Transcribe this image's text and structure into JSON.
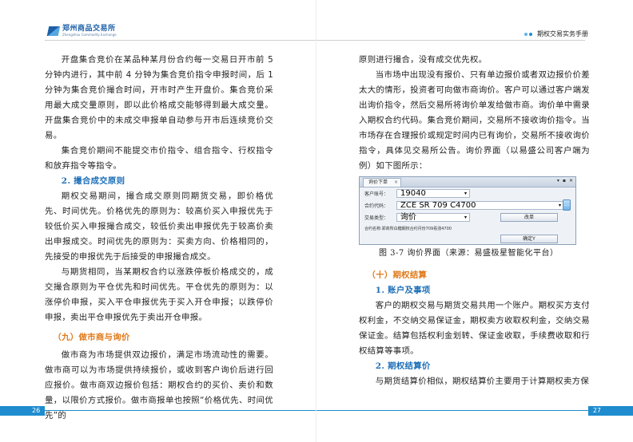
{
  "header": {
    "logo_cn": "郑州商品交易所",
    "logo_en": "Zhengzhou Commodity Exchange",
    "book_title": "期权交易实务手册",
    "dot_colors": [
      "#5fb3e8",
      "#1e8ccf"
    ]
  },
  "left_page": {
    "page_number": "26",
    "paragraphs": [
      {
        "type": "body_cont",
        "text": "开盘集合竞价在某品种某月份合约每一交易日开市前 5 分钟内进行，其中前 4 分钟为集合竞价指令申报时间，后 1 分钟为集合竞价撮合时间，开市时产生开盘价。集合竞价采用最大成交量原则，即以此价格成交能够得到最大成交量。开盘集合竞价中的未成交申报单自动参与开市后连续竞价交易。"
      },
      {
        "type": "body",
        "text": "集合竞价期间不能提交市价指令、组合指令、行权指令和放弃指令等指令。"
      },
      {
        "type": "h2",
        "text": "2. 撮合成交原则"
      },
      {
        "type": "body",
        "text": "期权交易期间，撮合成交原则同期货交易，即价格优先、时间优先。价格优先的原则为：较高价买入申报优先于较低价买入申报撮合成交，较低价卖出申报优先于较高价卖出申报成交。时间优先的原则为：买卖方向、价格相同的，先接受的申报优先于后接受的申报撮合成交。"
      },
      {
        "type": "body",
        "text": "与期货相同，当某期权合约以涨跌停板价格成交的，成交撮合原则为平仓优先和时间优先。平仓优先的原则为：以涨停价申报，买入平仓申报优先于买入开仓申报；以跌停价申报，卖出平仓申报优先于卖出开仓申报。"
      },
      {
        "type": "h1",
        "text": "（九）做市商与询价"
      },
      {
        "type": "body",
        "text": "做市商为市场提供双边报价，满足市场流动性的需要。做市商可以为市场提供持续报价，或收到客户询价后进行回应报价。做市商双边报价包括：期权合约的买价、卖价和数量，以限价方式报价。做市商报单也按照“价格优先、时间优先”的"
      }
    ]
  },
  "right_page": {
    "page_number": "27",
    "paragraphs_top": [
      {
        "type": "body_cont",
        "text": "原则进行撮合，没有成交优先权。"
      },
      {
        "type": "body",
        "text": "当市场中出现没有报价、只有单边报价或者双边报价价差太大的情形，投资者可向做市商询价。客户可以通过客户端发出询价指令，然后交易所将询价单发给做市商。询价单中需录入期权合约代码。集合竞价期间，交易所不接收询价指令。当市场存在合理报价或规定时间内已有询价，交易所不接收询价指令，具体见交易所公告。询价界面（以易盛公司客户端为例）如下图所示："
      }
    ],
    "figure": {
      "tab_label": "询价下单",
      "win_controls": [
        "▾",
        "▪",
        "✕"
      ],
      "fields": [
        {
          "label": "客户账号：",
          "value": "19040"
        },
        {
          "label": "合约代码：",
          "value": "ZCE SR 709 C4700"
        },
        {
          "label": "交易类型：",
          "value": "询价"
        }
      ],
      "reset_button": "改单",
      "confirm_button": "确定Y",
      "info_line": "合约名称:郑商所白糖期权合约月份709看涨4700",
      "caption": "图 3-7  询价界面（来源：易盛极星智能化平台）"
    },
    "paragraphs_bottom": [
      {
        "type": "h1",
        "text": "（十）期权结算"
      },
      {
        "type": "h2",
        "text": "1. 账户及事项"
      },
      {
        "type": "body",
        "text": "客户的期权交易与期货交易共用一个账户。期权买方支付权利金，不交纳交易保证金，期权卖方收取权利金，交纳交易保证金。结算包括权利金划转、保证金收取，手续费收取和行权结算等事项。"
      },
      {
        "type": "h2",
        "text": "2. 期权结算价"
      },
      {
        "type": "body",
        "text": "与期货结算价相似，期权结算价主要用于计算期权卖方保"
      }
    ]
  }
}
